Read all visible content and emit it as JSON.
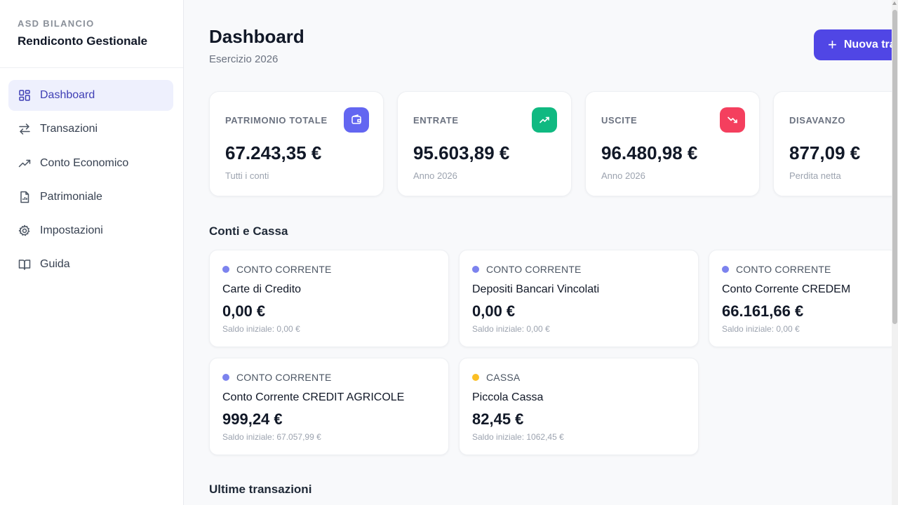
{
  "sidebar": {
    "kicker": "ASD BILANCIO",
    "title": "Rendiconto Gestionale",
    "items": [
      {
        "label": "Dashboard",
        "icon": "dashboard-icon",
        "active": true
      },
      {
        "label": "Transazioni",
        "icon": "transfer-arrows-icon"
      },
      {
        "label": "Conto Economico",
        "icon": "trend-up-icon"
      },
      {
        "label": "Patrimoniale",
        "icon": "report-document-icon"
      },
      {
        "label": "Impostazioni",
        "icon": "gear-icon"
      },
      {
        "label": "Guida",
        "icon": "book-icon"
      }
    ]
  },
  "header": {
    "title": "Dashboard",
    "subtitle": "Esercizio 2026",
    "new_button_label": "Nuova transazione"
  },
  "stats": [
    {
      "label": "PATRIMONIO TOTALE",
      "value": "67.243,35 €",
      "sub": "Tutti i conti",
      "icon": "wallet-icon",
      "color": "#6366f1"
    },
    {
      "label": "ENTRATE",
      "value": "95.603,89 €",
      "sub": "Anno 2026",
      "icon": "trend-up-icon",
      "color": "#10b981"
    },
    {
      "label": "USCITE",
      "value": "96.480,98 €",
      "sub": "Anno 2026",
      "icon": "trend-down-icon",
      "color": "#f43f5e"
    },
    {
      "label": "DISAVANZO",
      "value": "877,09 €",
      "sub": "Perdita netta",
      "icon": "",
      "color": ""
    }
  ],
  "accounts_section": {
    "title": "Conti e Cassa",
    "accounts": [
      {
        "type": "CONTO CORRENTE",
        "name": "Carte di Credito",
        "balance": "0,00 €",
        "initial": "Saldo iniziale: 0,00 €",
        "dot_color": "#7c83ee"
      },
      {
        "type": "CONTO CORRENTE",
        "name": "Depositi Bancari Vincolati",
        "balance": "0,00 €",
        "initial": "Saldo iniziale: 0,00 €",
        "dot_color": "#7c83ee"
      },
      {
        "type": "CONTO CORRENTE",
        "name": "Conto Corrente CREDEM",
        "balance": "66.161,66 €",
        "initial": "Saldo iniziale: 0,00 €",
        "dot_color": "#7c83ee"
      },
      {
        "type": "CONTO CORRENTE",
        "name": "Conto Corrente CREDIT AGRICOLE",
        "balance": "999,24 €",
        "initial": "Saldo iniziale: 67.057,99 €",
        "dot_color": "#7c83ee"
      },
      {
        "type": "CASSA",
        "name": "Piccola Cassa",
        "balance": "82,45 €",
        "initial": "Saldo iniziale: 1062,45 €",
        "dot_color": "#fbbf24"
      }
    ]
  },
  "transactions_section": {
    "title": "Ultime transazioni"
  }
}
